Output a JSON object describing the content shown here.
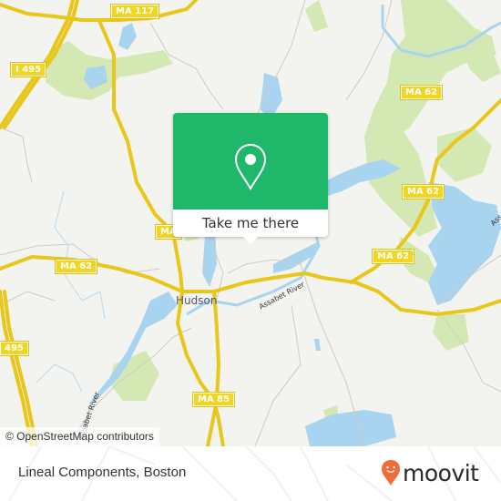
{
  "map": {
    "road_shields": [
      {
        "label": "MA 117"
      },
      {
        "label": "I 495"
      },
      {
        "label": "MA 62"
      },
      {
        "label": "MA 62"
      },
      {
        "label": "MA 62"
      },
      {
        "label": "MA 62"
      },
      {
        "label": "495"
      },
      {
        "label": "MA 85"
      },
      {
        "label": "MA"
      }
    ],
    "place_labels": {
      "hudson": "Hudson"
    },
    "river_labels": {
      "assabet_center": "Assabet River",
      "assabet_south": "Assabet River",
      "assabet_east": "Ass"
    },
    "attribution": "© OpenStreetMap contributors",
    "colors": {
      "land": "#f3f3ef",
      "water": "#a8d4ef",
      "park": "#d4e8b4",
      "road": "#f2d51f",
      "popup_green": "#1fb86a"
    }
  },
  "popup": {
    "action_label": "Take me there",
    "icon": "map-pin-icon"
  },
  "footer": {
    "place_name": "Lineal Components, Boston",
    "brand": "moovit",
    "brand_color": "#f26b3a"
  }
}
